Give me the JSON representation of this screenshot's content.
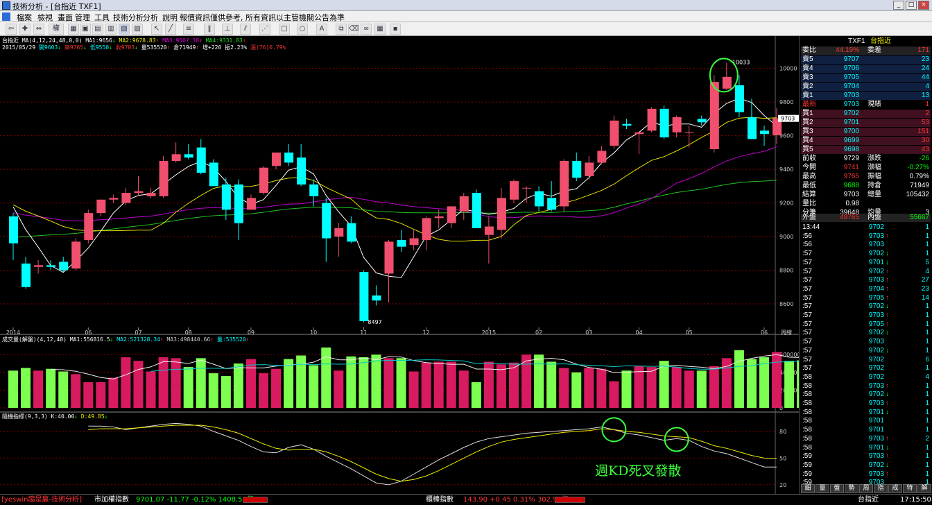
{
  "window": {
    "title": "技術分析 - [台指近 TXF1]"
  },
  "menu": [
    "檔案",
    "檢視",
    "畫面",
    "管理",
    "工具",
    "技術分析",
    "分析",
    "說明",
    "報價資訊僅供參考, 所有資訊以主管機關公告為準"
  ],
  "toolbar": {
    "zoom_label": "權"
  },
  "chart": {
    "info_line1": {
      "label": "台指近",
      "ma_spec": "MA(4,12,24,48,0,0)",
      "ma1": "MA1:9656",
      "ma1_arrow": "↓",
      "ma2": "MA2:9678.83",
      "ma2_arrow": "↑",
      "ma3": "MA3:9507.38",
      "ma3_arrow": "↑",
      "ma4": "MA4:9331.83",
      "ma4_arrow": "↑"
    },
    "info_line2": {
      "date": "2015/05/29",
      "open": "開9603",
      "open_arrow": "↓",
      "high": "高9765",
      "high_arrow": "↓",
      "low": "低9550",
      "low_arrow": "↓",
      "close": "收9703",
      "close_arrow": "↓",
      "vol": "量535520",
      "vol_arrow": "↑",
      "oi": "倉71949",
      "oi_arrow": "↑",
      "chg": "增+220",
      "pct": "振2.23%",
      "rise": "漲(76)0.79%"
    },
    "high_label": "10033",
    "low_label": "8497",
    "price_tag": "9703",
    "x_axis_suffix": "周線",
    "vol_info": {
      "label": "成交量(解盤)(4,12,48)",
      "ma1": "MA1:556816.5",
      "ma1_arrow": "↓",
      "ma2": "MA2:521328.34",
      "ma2_arrow": "↑",
      "ma3": "MA3:498440.66",
      "ma3_arrow": "↑",
      "vol": "量:535520",
      "vol_arrow": "↑"
    },
    "kd_info": {
      "label": "隨機指標(9,3,3)",
      "k": "K:40.00",
      "k_arrow": "↓",
      "d": "D:49.85",
      "d_arrow": "↓"
    },
    "annotation": "週KD死叉發散"
  },
  "chart_data": [
    {
      "type": "candlestick",
      "title": "台指近",
      "x_tick_labels": [
        "2014",
        "06",
        "07",
        "08",
        "09",
        "10",
        "11",
        "12",
        "2015",
        "02",
        "03",
        "04",
        "05",
        "06"
      ],
      "y_ticks": [
        8600,
        8800,
        9000,
        9200,
        9400,
        9600,
        9800,
        10000
      ],
      "ylim": [
        8460,
        10110
      ],
      "candles": [
        {
          "o": 9120,
          "h": 9140,
          "l": 8860,
          "c": 8960
        },
        {
          "o": 8840,
          "h": 8880,
          "l": 8690,
          "c": 8700
        },
        {
          "o": 8820,
          "h": 8860,
          "l": 8780,
          "c": 8830
        },
        {
          "o": 8830,
          "h": 8860,
          "l": 8800,
          "c": 8820
        },
        {
          "o": 8850,
          "h": 8880,
          "l": 8790,
          "c": 8800
        },
        {
          "o": 8810,
          "h": 8990,
          "l": 8800,
          "c": 8970
        },
        {
          "o": 8980,
          "h": 9160,
          "l": 8960,
          "c": 9140
        },
        {
          "o": 9140,
          "h": 9220,
          "l": 9120,
          "c": 9220
        },
        {
          "o": 9220,
          "h": 9250,
          "l": 9200,
          "c": 9230
        },
        {
          "o": 9200,
          "h": 9290,
          "l": 9190,
          "c": 9260
        },
        {
          "o": 9260,
          "h": 9360,
          "l": 9240,
          "c": 9270
        },
        {
          "o": 9240,
          "h": 9290,
          "l": 9230,
          "c": 9260
        },
        {
          "o": 9240,
          "h": 9480,
          "l": 9230,
          "c": 9450
        },
        {
          "o": 9450,
          "h": 9560,
          "l": 9440,
          "c": 9490
        },
        {
          "o": 9490,
          "h": 9550,
          "l": 9460,
          "c": 9470
        },
        {
          "o": 9530,
          "h": 9580,
          "l": 9370,
          "c": 9380
        },
        {
          "o": 9440,
          "h": 9460,
          "l": 9300,
          "c": 9300
        },
        {
          "o": 9310,
          "h": 9350,
          "l": 9100,
          "c": 9160
        },
        {
          "o": 9310,
          "h": 9340,
          "l": 8980,
          "c": 9080
        },
        {
          "o": 9160,
          "h": 9250,
          "l": 9160,
          "c": 9230
        },
        {
          "o": 9260,
          "h": 9420,
          "l": 9250,
          "c": 9410
        },
        {
          "o": 9420,
          "h": 9500,
          "l": 9400,
          "c": 9500
        },
        {
          "o": 9500,
          "h": 9550,
          "l": 9420,
          "c": 9440
        },
        {
          "o": 9470,
          "h": 9550,
          "l": 9300,
          "c": 9310
        },
        {
          "o": 9310,
          "h": 9340,
          "l": 9180,
          "c": 9240
        },
        {
          "o": 9200,
          "h": 9230,
          "l": 8850,
          "c": 8990
        },
        {
          "o": 9000,
          "h": 9080,
          "l": 8880,
          "c": 9050
        },
        {
          "o": 9080,
          "h": 9120,
          "l": 8960,
          "c": 8970
        },
        {
          "o": 8790,
          "h": 8800,
          "l": 8490,
          "c": 8497
        },
        {
          "o": 8650,
          "h": 8710,
          "l": 8590,
          "c": 8620
        },
        {
          "o": 8780,
          "h": 8980,
          "l": 8610,
          "c": 8970
        },
        {
          "o": 8980,
          "h": 9040,
          "l": 8910,
          "c": 8940
        },
        {
          "o": 8950,
          "h": 9040,
          "l": 8920,
          "c": 8990
        },
        {
          "o": 8980,
          "h": 9120,
          "l": 8920,
          "c": 9110
        },
        {
          "o": 9110,
          "h": 9160,
          "l": 9050,
          "c": 9120
        },
        {
          "o": 9080,
          "h": 9180,
          "l": 9050,
          "c": 9180
        },
        {
          "o": 9150,
          "h": 9260,
          "l": 9100,
          "c": 9240
        },
        {
          "o": 9260,
          "h": 9280,
          "l": 9050,
          "c": 9050
        },
        {
          "o": 9010,
          "h": 9120,
          "l": 8840,
          "c": 9060
        },
        {
          "o": 9040,
          "h": 9290,
          "l": 8990,
          "c": 9230
        },
        {
          "o": 9220,
          "h": 9340,
          "l": 9200,
          "c": 9330
        },
        {
          "o": 9290,
          "h": 9300,
          "l": 9200,
          "c": 9290
        },
        {
          "o": 9270,
          "h": 9300,
          "l": 9150,
          "c": 9180
        },
        {
          "o": 9230,
          "h": 9330,
          "l": 9150,
          "c": 9160
        },
        {
          "o": 9180,
          "h": 9460,
          "l": 9150,
          "c": 9450
        },
        {
          "o": 9450,
          "h": 9500,
          "l": 9330,
          "c": 9350
        },
        {
          "o": 9360,
          "h": 9480,
          "l": 9340,
          "c": 9440
        },
        {
          "o": 9440,
          "h": 9540,
          "l": 9430,
          "c": 9510
        },
        {
          "o": 9540,
          "h": 9720,
          "l": 9520,
          "c": 9690
        },
        {
          "o": 9670,
          "h": 9700,
          "l": 9640,
          "c": 9660
        },
        {
          "o": 9610,
          "h": 9620,
          "l": 9490,
          "c": 9620
        },
        {
          "o": 9630,
          "h": 9770,
          "l": 9620,
          "c": 9760
        },
        {
          "o": 9760,
          "h": 9780,
          "l": 9580,
          "c": 9590
        },
        {
          "o": 9620,
          "h": 9720,
          "l": 9590,
          "c": 9710
        },
        {
          "o": 9620,
          "h": 9660,
          "l": 9530,
          "c": 9620
        },
        {
          "o": 9700,
          "h": 9720,
          "l": 9660,
          "c": 9680
        },
        {
          "o": 9520,
          "h": 9960,
          "l": 9500,
          "c": 9920
        },
        {
          "o": 9880,
          "h": 10033,
          "l": 9870,
          "c": 9950
        },
        {
          "o": 9900,
          "h": 9960,
          "l": 9710,
          "c": 9740
        },
        {
          "o": 9710,
          "h": 9820,
          "l": 9580,
          "c": 9580
        },
        {
          "o": 9630,
          "h": 9660,
          "l": 9540,
          "c": 9610
        },
        {
          "o": 9603,
          "h": 9765,
          "l": 9550,
          "c": 9703
        }
      ]
    },
    {
      "type": "bar",
      "title": "成交量(解盤)",
      "y_ticks": [
        0,
        200000,
        400000,
        600000
      ],
      "ylim": [
        0,
        750000
      ],
      "values": [
        420000,
        450000,
        420000,
        440000,
        410000,
        380000,
        290000,
        290000,
        340000,
        570000,
        530000,
        410000,
        570000,
        560000,
        460000,
        560000,
        390000,
        360000,
        500000,
        550000,
        390000,
        440000,
        550000,
        590000,
        480000,
        680000,
        420000,
        580000,
        570000,
        600000,
        560000,
        560000,
        410000,
        510000,
        520000,
        520000,
        420000,
        290000,
        520000,
        490000,
        510000,
        600000,
        600000,
        520000,
        450000,
        400000,
        450000,
        440000,
        300000,
        420000,
        470000,
        460000,
        530000,
        460000,
        420000,
        420000,
        470000,
        560000,
        650000,
        550000,
        570000,
        630000,
        530000,
        535520
      ]
    },
    {
      "type": "line",
      "title": "隨機指標(9,3,3)",
      "y_ticks": [
        20,
        50,
        80
      ],
      "ylim": [
        16,
        94
      ],
      "series": [
        {
          "name": "K",
          "values": [
            86,
            86,
            85,
            82,
            84,
            86,
            88,
            89,
            88,
            86,
            80,
            75,
            70,
            63,
            57,
            56,
            62,
            65,
            60,
            52,
            45,
            38,
            30,
            22,
            20,
            24,
            32,
            40,
            48,
            55,
            62,
            68,
            72,
            74,
            76,
            78,
            79,
            80,
            81,
            82,
            83,
            85,
            82,
            78,
            76,
            73,
            70,
            72,
            70,
            63,
            58,
            55,
            50,
            45,
            40,
            40
          ]
        },
        {
          "name": "D",
          "values": [
            82,
            83,
            83,
            83,
            84,
            85,
            86,
            87,
            87,
            87,
            85,
            82,
            78,
            72,
            66,
            61,
            59,
            60,
            60,
            57,
            52,
            46,
            39,
            32,
            27,
            24,
            26,
            30,
            36,
            43,
            50,
            57,
            63,
            68,
            71,
            73,
            75,
            77,
            79,
            80,
            81,
            83,
            82,
            80,
            79,
            77,
            75,
            74,
            73,
            69,
            64,
            61,
            57,
            53,
            50,
            49.85
          ]
        }
      ]
    }
  ],
  "quote": {
    "symbol": "TXF1",
    "symbol_name": "台指近",
    "ratio_label": "委比",
    "ratio_value": "44.19%",
    "diff_label": "委差",
    "diff_value": "171",
    "asks": [
      {
        "label": "賣5",
        "price": "9707",
        "qty": "23"
      },
      {
        "label": "賣4",
        "price": "9706",
        "qty": "24"
      },
      {
        "label": "賣3",
        "price": "9705",
        "qty": "44"
      },
      {
        "label": "賣2",
        "price": "9704",
        "qty": "4"
      },
      {
        "label": "賣1",
        "price": "9703",
        "qty": "13"
      }
    ],
    "last_label": "最新",
    "last_price": "9703",
    "cur_label": "現賬",
    "cur_qty": "1",
    "bids": [
      {
        "label": "買1",
        "price": "9702",
        "qty": "2"
      },
      {
        "label": "買2",
        "price": "9701",
        "qty": "53"
      },
      {
        "label": "買3",
        "price": "9700",
        "qty": "151"
      },
      {
        "label": "買4",
        "price": "9699",
        "qty": "30"
      },
      {
        "label": "買5",
        "price": "9698",
        "qty": "43"
      }
    ],
    "stats": [
      {
        "l1": "前收",
        "v1": "9729",
        "l2": "漲跌",
        "v2": "-26",
        "c1": "#fff",
        "c2": "#0f0"
      },
      {
        "l1": "今開",
        "v1": "9741",
        "l2": "漲幅",
        "v2": "-0.27%",
        "c1": "#f33",
        "c2": "#0f0"
      },
      {
        "l1": "最高",
        "v1": "9765",
        "l2": "振幅",
        "v2": "0.79%",
        "c1": "#f33",
        "c2": "#fff"
      },
      {
        "l1": "最低",
        "v1": "9688",
        "l2": "持倉",
        "v2": "71949",
        "c1": "#0f0",
        "c2": "#fff"
      },
      {
        "l1": "結算",
        "v1": "9703",
        "l2": "總量",
        "v2": "105432",
        "c1": "#fff",
        "c2": "#fff"
      },
      {
        "l1": "量比",
        "v1": "0.98",
        "l2": "",
        "v2": "",
        "c1": "#fff",
        "c2": "#fff"
      },
      {
        "l1": "分筆",
        "v1": "39648",
        "l2": "均量",
        "v2": "3",
        "c1": "#fff",
        "c2": "#fff"
      }
    ],
    "outer_label": "外盤",
    "outer_value": "49765",
    "inner_label": "內盤",
    "inner_value": "55667",
    "ticks": [
      {
        "t": "13:44",
        "p": "9702",
        "a": "",
        "q": "1",
        "pc": "#0ff"
      },
      {
        "t": ":56",
        "p": "9703",
        "a": "↑",
        "q": "1",
        "pc": "#0ff"
      },
      {
        "t": ":56",
        "p": "9703",
        "a": "",
        "q": "1",
        "pc": "#0ff"
      },
      {
        "t": ":57",
        "p": "9702",
        "a": "↓",
        "q": "1",
        "pc": "#0ff"
      },
      {
        "t": ":57",
        "p": "9701",
        "a": "↓",
        "q": "5",
        "pc": "#0ff"
      },
      {
        "t": ":57",
        "p": "9702",
        "a": "↑",
        "q": "4",
        "pc": "#0ff"
      },
      {
        "t": ":57",
        "p": "9703",
        "a": "↑",
        "q": "27",
        "pc": "#0ff"
      },
      {
        "t": ":57",
        "p": "9704",
        "a": "↑",
        "q": "23",
        "pc": "#0ff"
      },
      {
        "t": ":57",
        "p": "9705",
        "a": "↑",
        "q": "14",
        "pc": "#0ff"
      },
      {
        "t": ":57",
        "p": "9702",
        "a": "↓",
        "q": "1",
        "pc": "#0ff"
      },
      {
        "t": ":57",
        "p": "9703",
        "a": "↑",
        "q": "1",
        "pc": "#0ff"
      },
      {
        "t": ":57",
        "p": "9705",
        "a": "↑",
        "q": "1",
        "pc": "#0ff"
      },
      {
        "t": ":57",
        "p": "9702",
        "a": "↓",
        "q": "1",
        "pc": "#0ff"
      },
      {
        "t": ":57",
        "p": "9703",
        "a": "",
        "q": "1",
        "pc": "#0ff"
      },
      {
        "t": ":57",
        "p": "9702",
        "a": "↓",
        "q": "1",
        "pc": "#0ff"
      },
      {
        "t": ":57",
        "p": "9702",
        "a": "",
        "q": "6",
        "pc": "#0ff"
      },
      {
        "t": ":57",
        "p": "9702",
        "a": "",
        "q": "1",
        "pc": "#0ff"
      },
      {
        "t": ":58",
        "p": "9702",
        "a": "",
        "q": "4",
        "pc": "#0ff"
      },
      {
        "t": ":58",
        "p": "9703",
        "a": "↑",
        "q": "1",
        "pc": "#0ff"
      },
      {
        "t": ":58",
        "p": "9702",
        "a": "↓",
        "q": "1",
        "pc": "#0ff"
      },
      {
        "t": ":58",
        "p": "9703",
        "a": "↑",
        "q": "1",
        "pc": "#0ff"
      },
      {
        "t": ":58",
        "p": "9701",
        "a": "↓",
        "q": "1",
        "pc": "#0ff"
      },
      {
        "t": ":58",
        "p": "9701",
        "a": "",
        "q": "1",
        "pc": "#0ff"
      },
      {
        "t": ":58",
        "p": "9701",
        "a": "",
        "q": "1",
        "pc": "#0ff"
      },
      {
        "t": ":58",
        "p": "9703",
        "a": "↑",
        "q": "2",
        "pc": "#0ff"
      },
      {
        "t": ":58",
        "p": "9701",
        "a": "↓",
        "q": "1",
        "pc": "#0ff"
      },
      {
        "t": ":59",
        "p": "9703",
        "a": "↑",
        "q": "1",
        "pc": "#0ff"
      },
      {
        "t": ":59",
        "p": "9702",
        "a": "↓",
        "q": "1",
        "pc": "#0ff"
      },
      {
        "t": ":59",
        "p": "9703",
        "a": "↑",
        "q": "1",
        "pc": "#0ff"
      },
      {
        "t": ":59",
        "p": "9703",
        "a": "",
        "q": "1",
        "pc": "#0ff"
      }
    ],
    "tabs": [
      "細",
      "量",
      "盤",
      "勢",
      "周",
      "指",
      "成",
      "特",
      "解"
    ]
  },
  "status": {
    "left": "[yeswin趨是贏-技術分析]",
    "idx_label": "市加權指數",
    "idx_value": "9701.07 -11.77 -0.12% 1408.51億",
    "otc_label": "櫃檯指數",
    "otc_value": "143.90 +0.45 0.31% 302.98億",
    "right_name": "台指近",
    "time": "17:15:50"
  },
  "colors": {
    "up": "#f0506e",
    "down": "#00ffff",
    "vol_up": "#d81b60",
    "vol_down": "#7cff4f",
    "ma1": "#ffffff",
    "ma2": "#e8e000",
    "ma3": "#c000d0",
    "ma4": "#20c020",
    "grid": "#8a0000",
    "annot": "#3aff3a"
  }
}
